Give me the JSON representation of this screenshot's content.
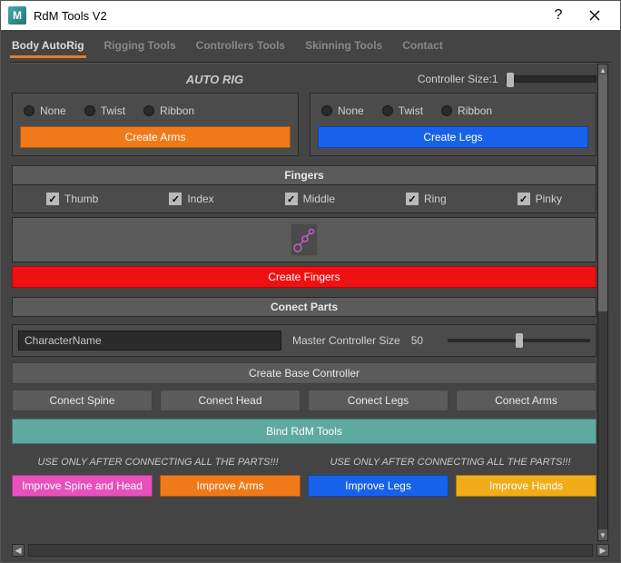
{
  "window": {
    "title": "RdM Tools V2",
    "logo_letter": "M"
  },
  "tabs": [
    "Body AutoRig",
    "Rigging Tools",
    "Controllers Tools",
    "Skinning Tools",
    "Contact"
  ],
  "active_tab": 0,
  "heading": "AUTO RIG",
  "controller_size_label": "Controller Size:",
  "controller_size_value": "1",
  "arm_options": [
    "None",
    "Twist",
    "Ribbon"
  ],
  "leg_options": [
    "None",
    "Twist",
    "Ribbon"
  ],
  "create_arms": "Create Arms",
  "create_legs": "Create Legs",
  "fingers_title": "Fingers",
  "finger_checks": [
    "Thumb",
    "Index",
    "Middle",
    "Ring",
    "Pinky"
  ],
  "create_fingers": "Create Fingers",
  "connect_title": "Conect Parts",
  "character_name": "CharacterName",
  "master_size_label": "Master Controller Size",
  "master_size_value": "50",
  "create_base": "Create Base Controller",
  "connect_buttons": [
    "Conect Spine",
    "Conect Head",
    "Conect Legs",
    "Conect Arms"
  ],
  "bind": "Bind RdM Tools",
  "warning": "USE ONLY AFTER CONNECTING ALL THE PARTS!!!",
  "improve": {
    "spine_head": "Improve Spine and Head",
    "arms": "Improve Arms",
    "legs": "Improve Legs",
    "hands": "Improve Hands"
  }
}
